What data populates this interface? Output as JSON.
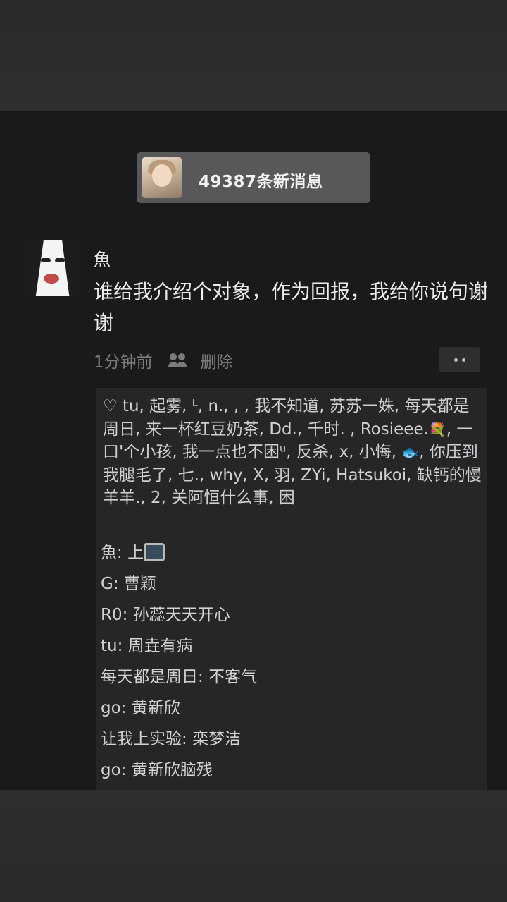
{
  "new_messages": {
    "text": "49387条新消息"
  },
  "post": {
    "author": "魚",
    "text": "谁给我介绍个对象，作为回报，我给你说句谢谢",
    "time": "1分钟前",
    "delete_label": "删除"
  },
  "likes": {
    "heart": "♡",
    "part1": " tu, 起雾, ᴸ, n., , , 我不知道, 苏苏一姝, 每天都是周日, 来一杯红豆奶茶, Dd., 千时. , Rosieee.",
    "flower": "💐",
    "part2": ", 一口'个小孩, 我一点也不困ᵘ, 反杀, x, 小悔, ",
    "fish": "🐟",
    "part3": ", 你压到我腿毛了, 七., why, X, 羽, ZYi, Hatsukoi, 缺钙的慢羊羊., 2, 关阿恒什么事, 困"
  },
  "comments": [
    {
      "author": "魚",
      "sep": ": ",
      "text": "上"
    },
    {
      "author": "G",
      "sep": ": ",
      "text": "曹颖"
    },
    {
      "author": "R0",
      "sep": ": ",
      "text": "孙蕊天天开心"
    },
    {
      "author": "tu",
      "sep": ": ",
      "text": "周垚有病"
    },
    {
      "author": "每天都是周日",
      "sep": ": ",
      "text": "不客气"
    },
    {
      "author": "go",
      "sep": ": ",
      "text": "黄新欣"
    },
    {
      "author": "让我上实验",
      "sep": ": ",
      "text": "栾梦洁"
    },
    {
      "author": "go",
      "sep": ": ",
      "text": "黄新欣脑残"
    }
  ],
  "icons": {
    "pill_avatar": "avatar-photo",
    "poster_avatar": "anime-avatar",
    "like_icon": "friends-icon",
    "more_icon": "more-dots-icon",
    "tv_icon": "tv-icon"
  }
}
